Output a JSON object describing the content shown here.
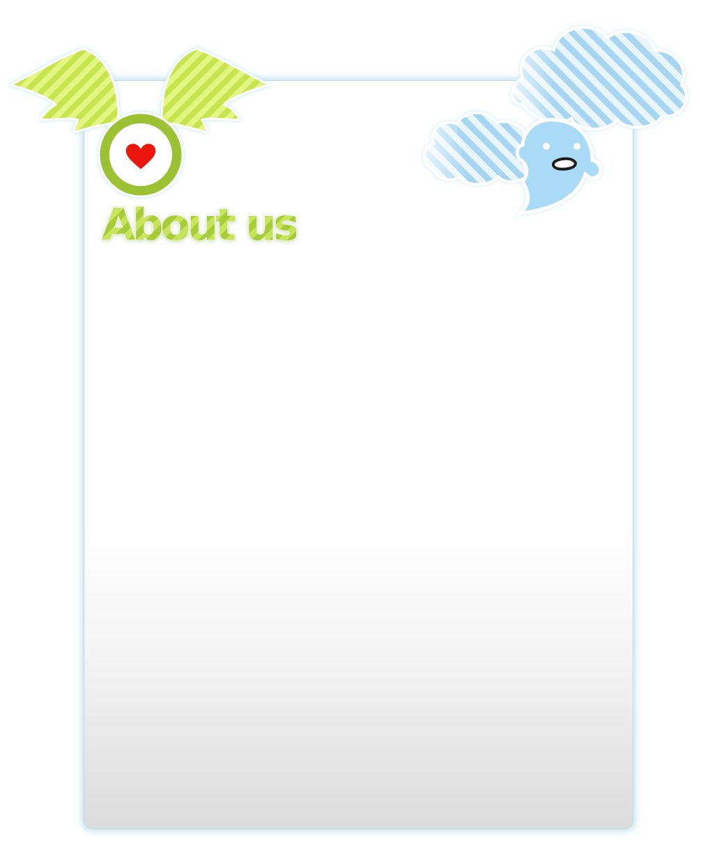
{
  "page": {
    "title": "About us"
  },
  "decor": {
    "badge_icon": "winged-heart-icon",
    "mascot_icon": "ghost-mascot-icon",
    "cloud_icon": "striped-cloud-icon"
  },
  "colors": {
    "title_green": "#b9d84a",
    "wing_green": "#d9f06c",
    "ring_green": "#9cc132",
    "heart_red": "#e8140a",
    "cloud_blue": "#9fd0f0",
    "ghost_blue": "#a9dbf7",
    "panel_border": "#b9dbe6"
  }
}
